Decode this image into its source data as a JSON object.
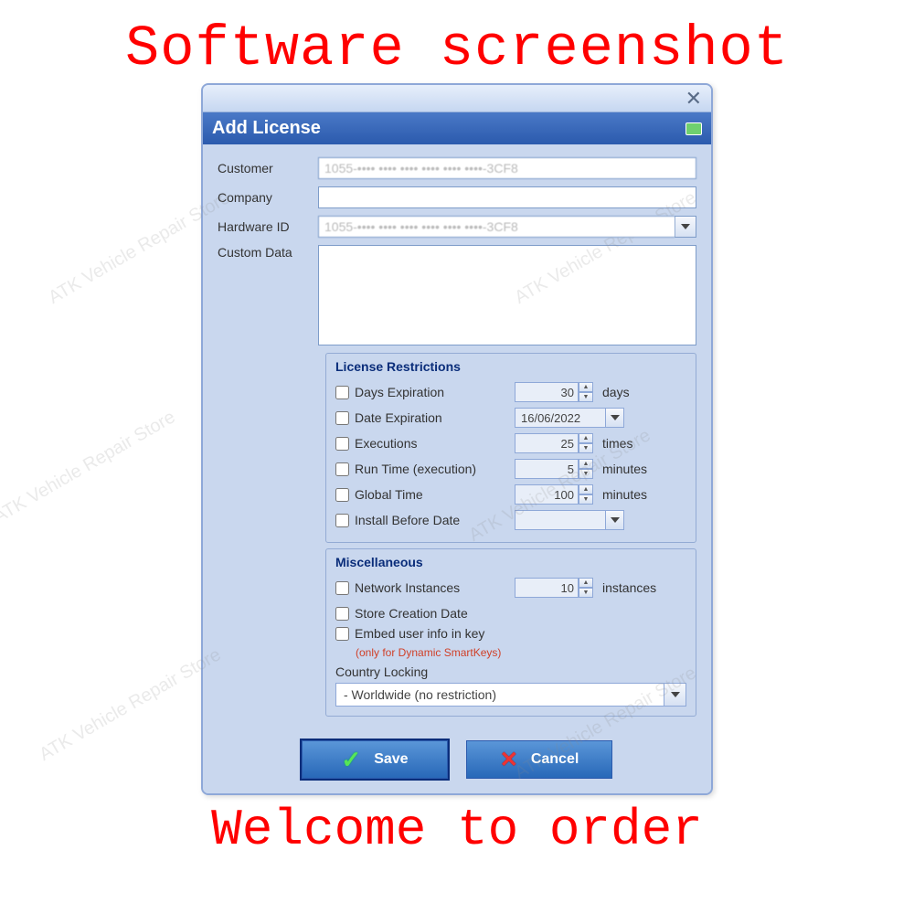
{
  "banners": {
    "top": "Software screenshot",
    "bottom": "Welcome to order"
  },
  "window": {
    "title": "Add License"
  },
  "fields": {
    "customer_label": "Customer",
    "customer_value": "1055-•••• •••• •••• •••• •••• ••••-3CF8",
    "company_label": "Company",
    "company_value": "",
    "hardwareid_label": "Hardware ID",
    "hardwareid_value": "1055-•••• •••• •••• •••• •••• ••••-3CF8",
    "customdata_label": "Custom Data",
    "customdata_value": ""
  },
  "restrictions": {
    "title": "License Restrictions",
    "days_expiration": {
      "label": "Days Expiration",
      "value": "30",
      "unit": "days",
      "checked": false
    },
    "date_expiration": {
      "label": "Date Expiration",
      "value": "16/06/2022",
      "checked": false
    },
    "executions": {
      "label": "Executions",
      "value": "25",
      "unit": "times",
      "checked": false
    },
    "run_time": {
      "label": "Run Time (execution)",
      "value": "5",
      "unit": "minutes",
      "checked": false
    },
    "global_time": {
      "label": "Global Time",
      "value": "100",
      "unit": "minutes",
      "checked": false
    },
    "install_before": {
      "label": "Install Before Date",
      "value": "",
      "checked": false
    }
  },
  "misc": {
    "title": "Miscellaneous",
    "network_instances": {
      "label": "Network Instances",
      "value": "10",
      "unit": "instances",
      "checked": false
    },
    "store_creation": {
      "label": "Store Creation Date",
      "checked": false
    },
    "embed_user_info": {
      "label": "Embed user info in key",
      "checked": false,
      "hint": "(only for Dynamic SmartKeys)"
    },
    "country_locking": {
      "label": "Country Locking",
      "value": "- Worldwide (no restriction)"
    }
  },
  "buttons": {
    "save": "Save",
    "cancel": "Cancel"
  },
  "watermark": "ATK Vehicle Repair Store"
}
